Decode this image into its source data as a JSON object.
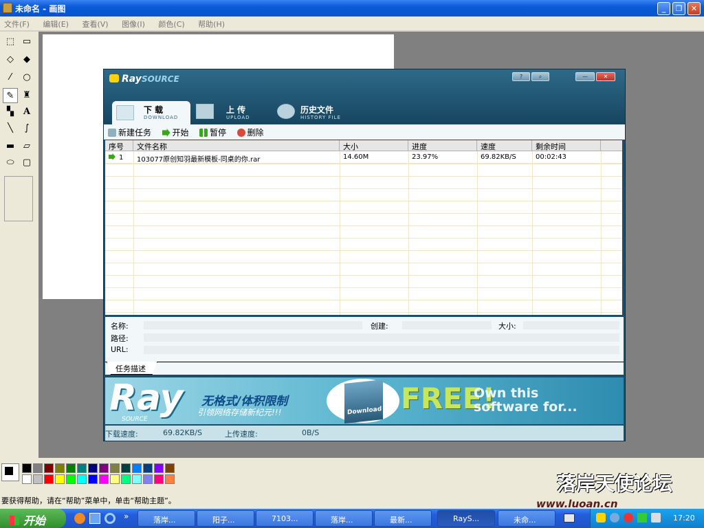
{
  "paint": {
    "title": "未命名 - 画图",
    "menu": [
      "文件(F)",
      "编辑(E)",
      "查看(V)",
      "图像(I)",
      "颜色(C)",
      "帮助(H)"
    ],
    "status": "要获得帮助，请在“帮助”菜单中，单击“帮助主题”。",
    "palette_top": [
      "#000000",
      "#808080",
      "#800000",
      "#808000",
      "#008000",
      "#008080",
      "#000080",
      "#800080",
      "#808040",
      "#004040",
      "#0080ff",
      "#004080",
      "#8000ff",
      "#804000"
    ],
    "palette_bottom": [
      "#ffffff",
      "#c0c0c0",
      "#ff0000",
      "#ffff00",
      "#00ff00",
      "#00ffff",
      "#0000ff",
      "#ff00ff",
      "#ffff80",
      "#00ff80",
      "#80ffff",
      "#8080ff",
      "#ff0080",
      "#ff8040"
    ],
    "tools": [
      "free-select",
      "rect-select",
      "eraser",
      "fill",
      "picker",
      "magnifier",
      "pencil",
      "brush",
      "airbrush",
      "text",
      "line",
      "curve",
      "rectangle",
      "polygon",
      "ellipse",
      "rounded-rect"
    ]
  },
  "ray": {
    "logo": "Ray",
    "logo_suffix": "SOURCE",
    "tabs": [
      {
        "label": "下 载",
        "sub": "DOWNLOAD"
      },
      {
        "label": "上 传",
        "sub": "UPLOAD"
      },
      {
        "label": "历史文件",
        "sub": "HISTORY FILE"
      }
    ],
    "toolbar": {
      "new": "新建任务",
      "start": "开始",
      "pause": "暂停",
      "delete": "删除"
    },
    "columns": [
      "序号",
      "文件名称",
      "大小",
      "进度",
      "速度",
      "剩余时间"
    ],
    "rows": [
      {
        "index": "1",
        "name": "103077原创知羽最新模板-同桌的你.rar",
        "size": "14.60M",
        "progress": "23.97%",
        "speed": "69.82KB/S",
        "remaining": "00:02:43"
      }
    ],
    "details": {
      "name_label": "名称:",
      "created_label": "创建:",
      "size_label": "大小:",
      "path_label": "路径:",
      "url_label": "URL:",
      "desc_tab": "任务描述"
    },
    "banner": {
      "brand": "Ray",
      "brand_sub": "SOURCE",
      "line1": "无格式/体积限制",
      "line2": "引领网络存储新纪元!!!",
      "box": "Download",
      "free": "FREE!",
      "own1": "Own this",
      "own2": "software for..."
    },
    "status": {
      "down_label": "下载速度:",
      "down_value": "69.82KB/S",
      "up_label": "上传速度:",
      "up_value": "0B/S"
    }
  },
  "taskbar": {
    "start": "开始",
    "tasks": [
      "落岸...",
      "阳子...",
      "7103...",
      "落岸...",
      "最新...",
      "RayS...",
      "未命..."
    ],
    "clock": "17:20"
  },
  "watermark": {
    "name": "落岸天使论坛",
    "site": "www.luoan.cn"
  }
}
